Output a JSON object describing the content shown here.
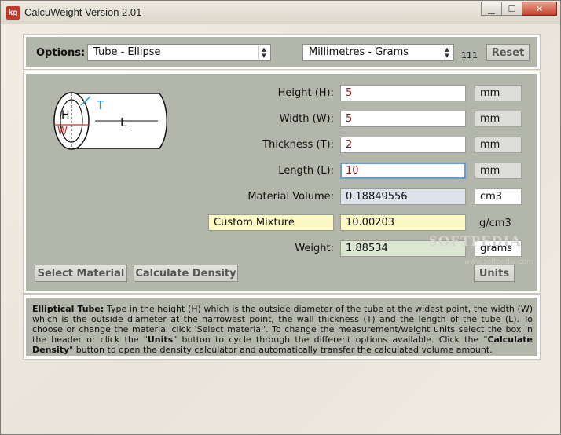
{
  "window": {
    "icon_text": "kg",
    "title": "CalcuWeight Version 2.01",
    "minimize": "▁",
    "maximize": "☐",
    "close": "✕"
  },
  "options": {
    "label": "Options:",
    "shape_select": "Tube - Ellipse",
    "units_select": "Millimetres - Grams",
    "counter": "111",
    "reset_label": "Reset"
  },
  "diagram": {
    "h": "H",
    "w": "W",
    "t": "T",
    "l": "L"
  },
  "fields": {
    "height": {
      "label": "Height (H):",
      "value": "5",
      "unit": "mm"
    },
    "width": {
      "label": "Width (W):",
      "value": "5",
      "unit": "mm"
    },
    "thickness": {
      "label": "Thickness (T):",
      "value": "2",
      "unit": "mm"
    },
    "length": {
      "label": "Length (L):",
      "value": "10",
      "unit": "mm"
    },
    "volume": {
      "label": "Material Volume:",
      "value": "0.18849556",
      "unit": "cm3"
    },
    "material": {
      "label": "Custom Mixture",
      "value": "10.00203",
      "unit": "g/cm3"
    },
    "weight": {
      "label": "Weight:",
      "value": "1.88534",
      "unit": "grams"
    }
  },
  "buttons": {
    "select_material": "Select Material",
    "calculate_density": "Calculate Density",
    "units": "Units"
  },
  "description": {
    "part1_bold": "Elliptical Tube:",
    "part1": " Type in the height (H) which is the outside diameter of the tube at the widest point, the width (W) which is the outside diameter at the narrowest point, the wall thickness (T) and the length of the tube (L). To choose or change the material click 'Select material'. To change the measurement/weight units select the box in the header or click the \"",
    "units_bold": "Units",
    "part2": "\" button to cycle through the different options available. Click the \"",
    "calc_bold": "Calculate Density",
    "part3": "\" button to open the density calculator and automatically transfer the calculated volume amount."
  },
  "watermark": {
    "text": "SOFTPEDIA",
    "url": "www.softpedia.com"
  },
  "colors": {
    "panel": "#b3b6aa",
    "value_text": "#8b1a1a",
    "focus_border": "#6c9bd2",
    "diagram_t": "#1e9be6",
    "diagram_w": "#d32f2f"
  }
}
